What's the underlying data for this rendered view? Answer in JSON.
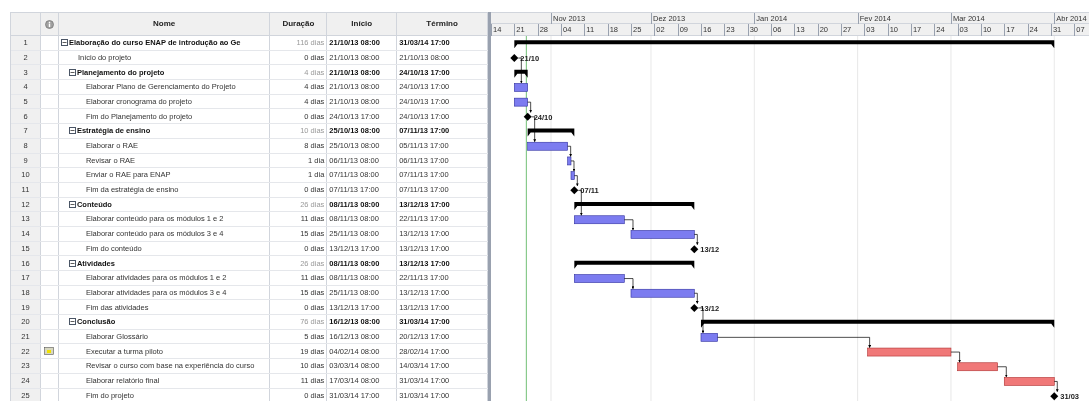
{
  "columns": [
    "Nome",
    "Duração",
    "Início",
    "Término"
  ],
  "timeline": {
    "months": [
      "Nov 2013",
      "Dez 2013",
      "Jan 2014",
      "Fev 2014",
      "Mar 2014",
      "Abr 2014"
    ],
    "weeks": [
      "14",
      "21",
      "28",
      "04",
      "11",
      "18",
      "25",
      "02",
      "09",
      "16",
      "23",
      "30",
      "06",
      "13",
      "20",
      "27",
      "03",
      "10",
      "17",
      "24",
      "03",
      "10",
      "17",
      "24",
      "31",
      "07"
    ]
  },
  "tasks": [
    {
      "row_number": "1",
      "kind": "summary",
      "expanded": true,
      "indicator": false,
      "name": "Elaboração do curso ENAP de introdução ao Ge",
      "duration": "116 dias",
      "start": "21/10/13 08:00",
      "finish": "31/03/14 17:00",
      "children": [
        {
          "row_number": "2",
          "kind": "milestone",
          "indicator": false,
          "name": "Início do projeto",
          "duration": "0 dias",
          "start": "21/10/13 08:00",
          "finish": "21/10/13 08:00",
          "milestone_label": "21/10"
        },
        {
          "row_number": "3",
          "kind": "summary",
          "expanded": true,
          "indicator": false,
          "name": "Planejamento do projeto",
          "duration": "4 dias",
          "start": "21/10/13 08:00",
          "finish": "24/10/13 17:00",
          "children": [
            {
              "row_number": "4",
              "kind": "task",
              "critical": false,
              "indicator": false,
              "name": "Elaborar Plano de Gerenciamento do Projeto",
              "duration": "4 dias",
              "start": "21/10/13 08:00",
              "finish": "24/10/13 17:00"
            },
            {
              "row_number": "5",
              "kind": "task",
              "critical": false,
              "indicator": false,
              "name": "Elaborar cronograma do projeto",
              "duration": "4 dias",
              "start": "21/10/13 08:00",
              "finish": "24/10/13 17:00"
            },
            {
              "row_number": "6",
              "kind": "milestone",
              "indicator": false,
              "name": "Fim do Planejamento do projeto",
              "duration": "0 dias",
              "start": "24/10/13 17:00",
              "finish": "24/10/13 17:00",
              "milestone_label": "24/10"
            }
          ]
        },
        {
          "row_number": "7",
          "kind": "summary",
          "expanded": true,
          "indicator": false,
          "name": "Estratégia de ensino",
          "duration": "10 dias",
          "start": "25/10/13 08:00",
          "finish": "07/11/13 17:00",
          "children": [
            {
              "row_number": "8",
              "kind": "task",
              "critical": false,
              "indicator": false,
              "name": "Elaborar o RAE",
              "duration": "8 dias",
              "start": "25/10/13 08:00",
              "finish": "05/11/13 17:00"
            },
            {
              "row_number": "9",
              "kind": "task",
              "critical": false,
              "indicator": false,
              "name": "Revisar o RAE",
              "duration": "1 dia",
              "start": "06/11/13 08:00",
              "finish": "06/11/13 17:00"
            },
            {
              "row_number": "10",
              "kind": "task",
              "critical": false,
              "indicator": false,
              "name": "Enviar o RAE para ENAP",
              "duration": "1 dia",
              "start": "07/11/13 08:00",
              "finish": "07/11/13 17:00"
            },
            {
              "row_number": "11",
              "kind": "milestone",
              "indicator": false,
              "name": "Fim da estratégia de ensino",
              "duration": "0 dias",
              "start": "07/11/13 17:00",
              "finish": "07/11/13 17:00",
              "milestone_label": "07/11"
            }
          ]
        },
        {
          "row_number": "12",
          "kind": "summary",
          "expanded": true,
          "indicator": false,
          "name": "Conteúdo",
          "duration": "26 dias",
          "start": "08/11/13 08:00",
          "finish": "13/12/13 17:00",
          "children": [
            {
              "row_number": "13",
              "kind": "task",
              "critical": false,
              "indicator": false,
              "name": "Elaborar conteúdo para os módulos 1 e 2",
              "duration": "11 dias",
              "start": "08/11/13 08:00",
              "finish": "22/11/13 17:00"
            },
            {
              "row_number": "14",
              "kind": "task",
              "critical": false,
              "indicator": false,
              "name": "Elaborar conteúdo para os módulos 3 e 4",
              "duration": "15 dias",
              "start": "25/11/13 08:00",
              "finish": "13/12/13 17:00"
            },
            {
              "row_number": "15",
              "kind": "milestone",
              "indicator": false,
              "name": "Fim do conteúdo",
              "duration": "0 dias",
              "start": "13/12/13 17:00",
              "finish": "13/12/13 17:00",
              "milestone_label": "13/12"
            }
          ]
        },
        {
          "row_number": "16",
          "kind": "summary",
          "expanded": true,
          "indicator": false,
          "name": "Atividades",
          "duration": "26 dias",
          "start": "08/11/13 08:00",
          "finish": "13/12/13 17:00",
          "children": [
            {
              "row_number": "17",
              "kind": "task",
              "critical": false,
              "indicator": false,
              "name": "Elaborar atividades para os módulos 1 e 2",
              "duration": "11 dias",
              "start": "08/11/13 08:00",
              "finish": "22/11/13 17:00"
            },
            {
              "row_number": "18",
              "kind": "task",
              "critical": false,
              "indicator": false,
              "name": "Elaborar atividades para os módulos 3 e 4",
              "duration": "15 dias",
              "start": "25/11/13 08:00",
              "finish": "13/12/13 17:00"
            },
            {
              "row_number": "19",
              "kind": "milestone",
              "indicator": false,
              "name": "Fim das atividades",
              "duration": "0 dias",
              "start": "13/12/13 17:00",
              "finish": "13/12/13 17:00",
              "milestone_label": "13/12"
            }
          ]
        },
        {
          "row_number": "20",
          "kind": "summary",
          "expanded": true,
          "indicator": false,
          "name": "Conclusão",
          "duration": "76 dias",
          "start": "16/12/13 08:00",
          "finish": "31/03/14 17:00",
          "children": [
            {
              "row_number": "21",
              "kind": "task",
              "critical": false,
              "indicator": false,
              "name": "Elaborar Glossário",
              "duration": "5 dias",
              "start": "16/12/13 08:00",
              "finish": "20/12/13 17:00"
            },
            {
              "row_number": "22",
              "kind": "task",
              "critical": true,
              "indicator": true,
              "name": "Executar a turma piloto",
              "duration": "19 dias",
              "start": "04/02/14 08:00",
              "finish": "28/02/14 17:00"
            },
            {
              "row_number": "23",
              "kind": "task",
              "critical": true,
              "indicator": false,
              "name": "Revisar o curso com base na experiência do curso",
              "duration": "10 dias",
              "start": "03/03/14 08:00",
              "finish": "14/03/14 17:00"
            },
            {
              "row_number": "24",
              "kind": "task",
              "critical": true,
              "indicator": false,
              "name": "Elaborar relatório final",
              "duration": "11 dias",
              "start": "17/03/14 08:00",
              "finish": "31/03/14 17:00"
            },
            {
              "row_number": "25",
              "kind": "milestone",
              "indicator": false,
              "name": "Fim do projeto",
              "duration": "0 dias",
              "start": "31/03/14 17:00",
              "finish": "31/03/14 17:00",
              "milestone_label": "31/03"
            }
          ]
        }
      ]
    }
  ]
}
